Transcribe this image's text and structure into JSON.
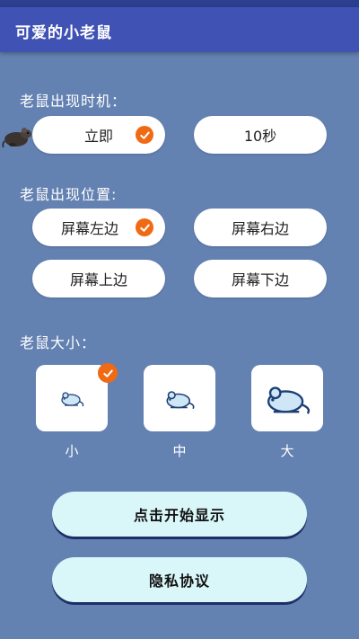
{
  "app": {
    "title": "可爱的小老鼠"
  },
  "timing": {
    "label": "老鼠出现时机：",
    "options": [
      {
        "label": "立即",
        "selected": true
      },
      {
        "label": "10秒",
        "selected": false
      }
    ]
  },
  "position": {
    "label": "老鼠出现位置:",
    "options": [
      {
        "label": "屏幕左边",
        "selected": true
      },
      {
        "label": "屏幕右边",
        "selected": false
      },
      {
        "label": "屏幕上边",
        "selected": false
      },
      {
        "label": "屏幕下边",
        "selected": false
      }
    ]
  },
  "size": {
    "label": "老鼠大小：",
    "options": [
      {
        "label": "小",
        "selected": true,
        "icon": "mouse-icon"
      },
      {
        "label": "中",
        "selected": false,
        "icon": "mouse-icon"
      },
      {
        "label": "大",
        "selected": false,
        "icon": "mouse-icon"
      }
    ]
  },
  "buttons": {
    "start": "点击开始显示",
    "privacy": "隐私协议"
  },
  "colors": {
    "background": "#6381b1",
    "appbar": "#4052b3",
    "check": "#f06a14",
    "button": "#d9f6f9"
  }
}
